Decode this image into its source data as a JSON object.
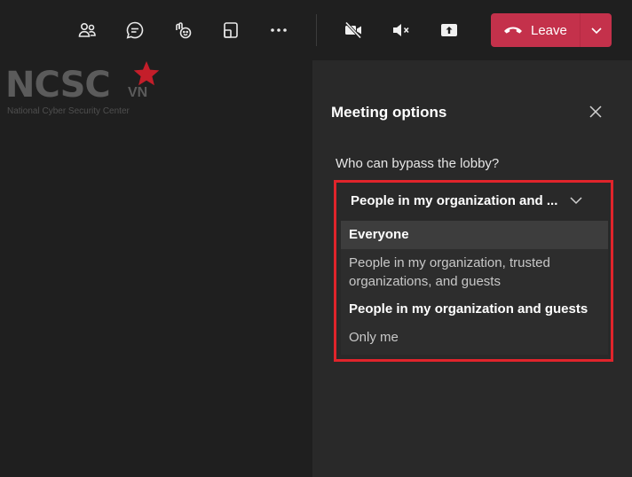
{
  "toolbar": {
    "buttons": [
      {
        "name": "participants-icon"
      },
      {
        "name": "chat-icon"
      },
      {
        "name": "reactions-icon"
      },
      {
        "name": "share-tray-icon"
      },
      {
        "name": "more-actions-icon"
      },
      {
        "name": "camera-off-icon"
      },
      {
        "name": "mute-icon"
      },
      {
        "name": "share-screen-icon"
      }
    ],
    "leave_label": "Leave"
  },
  "logo": {
    "text": "NCSC",
    "suffix": "VN",
    "subtitle": "National Cyber Security Center",
    "color": "#5b5b5b",
    "star_color": "#c41e2a"
  },
  "panel": {
    "title": "Meeting options",
    "question": "Who can bypass the lobby?",
    "selected_value": "People in my organization and ...",
    "options": [
      {
        "label": "Everyone",
        "style": "hovered"
      },
      {
        "label": "People in my organization, trusted organizations, and guests",
        "style": "dim"
      },
      {
        "label": "People in my organization and guests",
        "style": "selected"
      },
      {
        "label": "Only me",
        "style": "dim"
      }
    ]
  },
  "colors": {
    "leave": "#c4314b",
    "highlight_border": "#e0242b",
    "background": "#1f1f1f",
    "panel": "#292929"
  }
}
